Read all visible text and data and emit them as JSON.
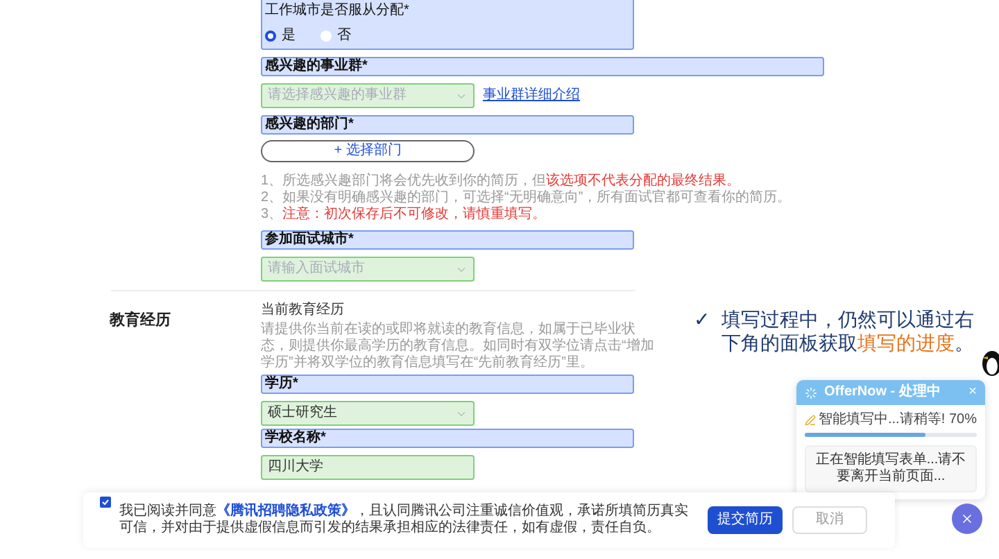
{
  "form": {
    "fields": [
      {
        "kind": "radio",
        "label": "工作城市是否服从分配*",
        "options": [
          {
            "label": "是",
            "selected": true
          },
          {
            "label": "否",
            "selected": false
          }
        ]
      },
      {
        "kind": "select",
        "label": "感兴趣的事业群*",
        "placeholder": "请选择感兴趣的事业群",
        "link": "事业群详细介绍",
        "wide": true
      },
      {
        "kind": "picker",
        "label": "感兴趣的部门*",
        "button": "+ 选择部门",
        "notes": [
          [
            {
              "text": "1、所选感兴趣部门将会优先收到你的简历，但",
              "highlight": false
            },
            {
              "text": "该选项不代表分配的最终结果。",
              "highlight": true
            }
          ],
          [
            {
              "text": "2、如果没有明确感兴趣的部门，可选择“无明确意向”，所有面试官都可查看你的简历。",
              "highlight": false
            }
          ],
          [
            {
              "text": "3、",
              "highlight": false
            },
            {
              "text": "注意：初次保存后不可修改，请慎重填写。",
              "highlight": true
            }
          ]
        ]
      },
      {
        "kind": "select",
        "label": "参加面试城市*",
        "placeholder": "请输入面试城市"
      }
    ]
  },
  "education": {
    "title": "教育经历",
    "subtitle": "当前教育经历",
    "description": "请提供你当前在读的或即将就读的教育信息，如属于已毕业状态，则提供你最高学历的教育信息。如同时有双学位请点击“增加学历”并将双学位的教育信息填写在“先前教育经历”里。",
    "fields": [
      {
        "kind": "select",
        "label": "学历*",
        "value": "硕士研究生"
      },
      {
        "kind": "input",
        "label": "学校名称*",
        "value": "四川大学"
      }
    ]
  },
  "footer": {
    "agree_checked": true,
    "agree_before": "我已阅读并同意",
    "agree_link": "《腾讯招聘隐私政策》",
    "agree_after": "，且认同腾讯公司注重诚信价值观，承诺所填简历真实可信，并对由于提供虚假信息而引发的结果承担相应的法律责任，如有虚假，责任自负。",
    "buttons": [
      {
        "label": "提交简历",
        "kind": "primary"
      },
      {
        "label": "取消",
        "kind": "secondary"
      }
    ]
  },
  "annotation": {
    "mark": "✓",
    "segments": [
      {
        "text": "填写过程中，仍然可以通过右下角的面板获取",
        "highlight": false
      },
      {
        "text": "填写的进度",
        "highlight": true
      },
      {
        "text": "。",
        "highlight": false
      }
    ]
  },
  "panel": {
    "title": "OfferNow - 处理中",
    "close": "×",
    "status": "智能填写中...请稍等!",
    "percent": "70%",
    "level": 0.7,
    "message": "正在智能填写表单...请不要离开当前页面..."
  }
}
